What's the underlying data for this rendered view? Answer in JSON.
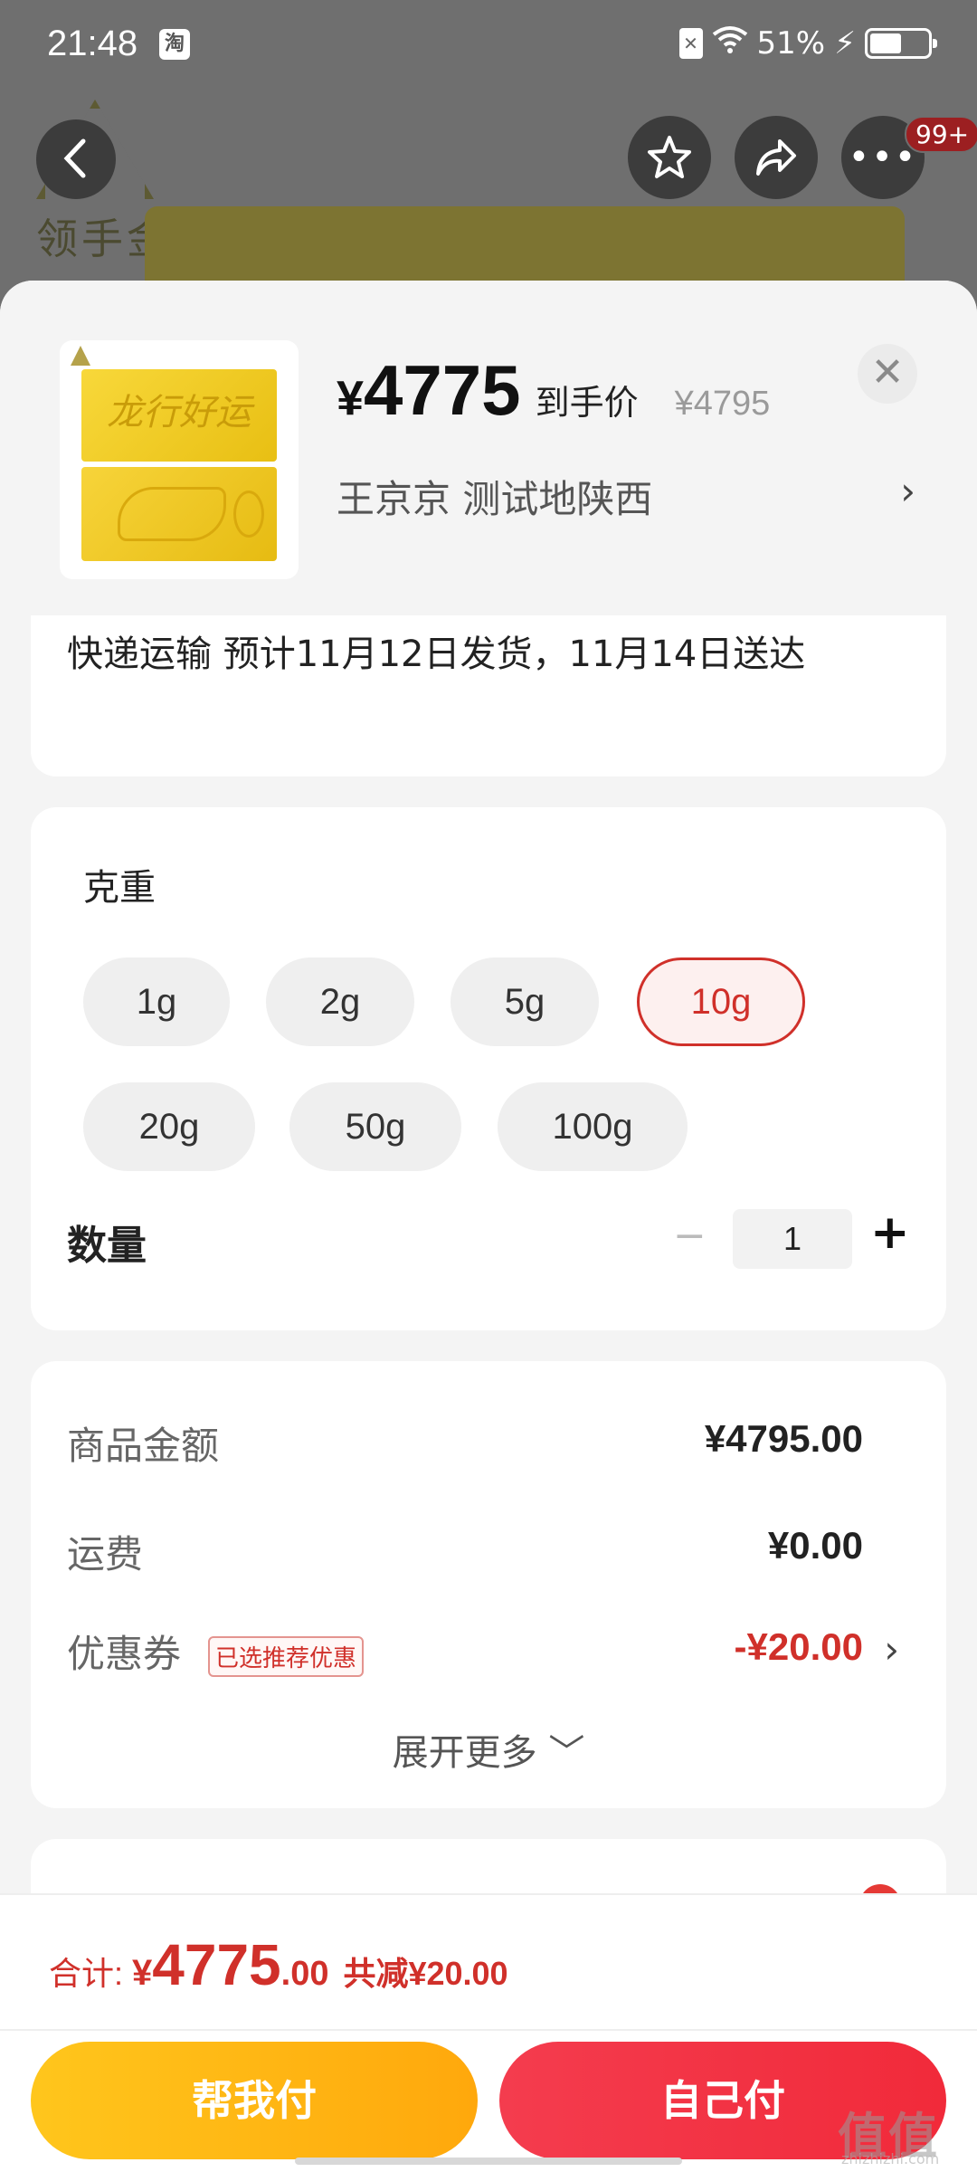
{
  "status_bar": {
    "time": "21:48",
    "app_badge": "淘",
    "battery": "51%"
  },
  "background": {
    "logo_text": "领手金"
  },
  "nav": {
    "back_icon": "chevron-left-icon",
    "favorite_icon": "star-icon",
    "share_icon": "share-icon",
    "more_icon": "more-icon",
    "badge": "99+"
  },
  "product": {
    "thumb_text": "龙行好运",
    "price_currency": "¥",
    "price": "4775",
    "price_tag": "到手价",
    "original_price": "¥4795",
    "address": "王京京  测试地陕西",
    "address_arrow": "›",
    "close": "✕"
  },
  "delivery": {
    "text": "快递运输 预计11月12日发货，11月14日送达"
  },
  "spec": {
    "title": "克重",
    "options": [
      "1g",
      "2g",
      "5g",
      "10g",
      "20g",
      "50g",
      "100g"
    ],
    "selected": "10g",
    "qty_label": "数量",
    "qty_minus": "−",
    "qty_value": "1",
    "qty_plus": "+"
  },
  "summary": {
    "goods_label": "商品金额",
    "goods_value": "¥4795.00",
    "shipping_label": "运费",
    "shipping_value": "¥0.00",
    "coupon_label": "优惠券",
    "coupon_tag": "已选推荐优惠",
    "coupon_value": "-¥20.00",
    "coupon_arrow": "›",
    "expand_more": "展开更多 ﹀"
  },
  "bottom": {
    "total_label": "合计:",
    "total_currency": "¥",
    "total_int": "4775",
    "total_dec": ".00",
    "total_saved": "共减¥20.00",
    "pay_friend": "帮我付",
    "pay_self": "自己付"
  },
  "watermark": {
    "text": "值值值",
    "sub": "zhizhizhi.com"
  },
  "colors": {
    "accent_red": "#d0302a",
    "pay_friend": "#ffb714",
    "pay_self": "#f43c4e"
  }
}
